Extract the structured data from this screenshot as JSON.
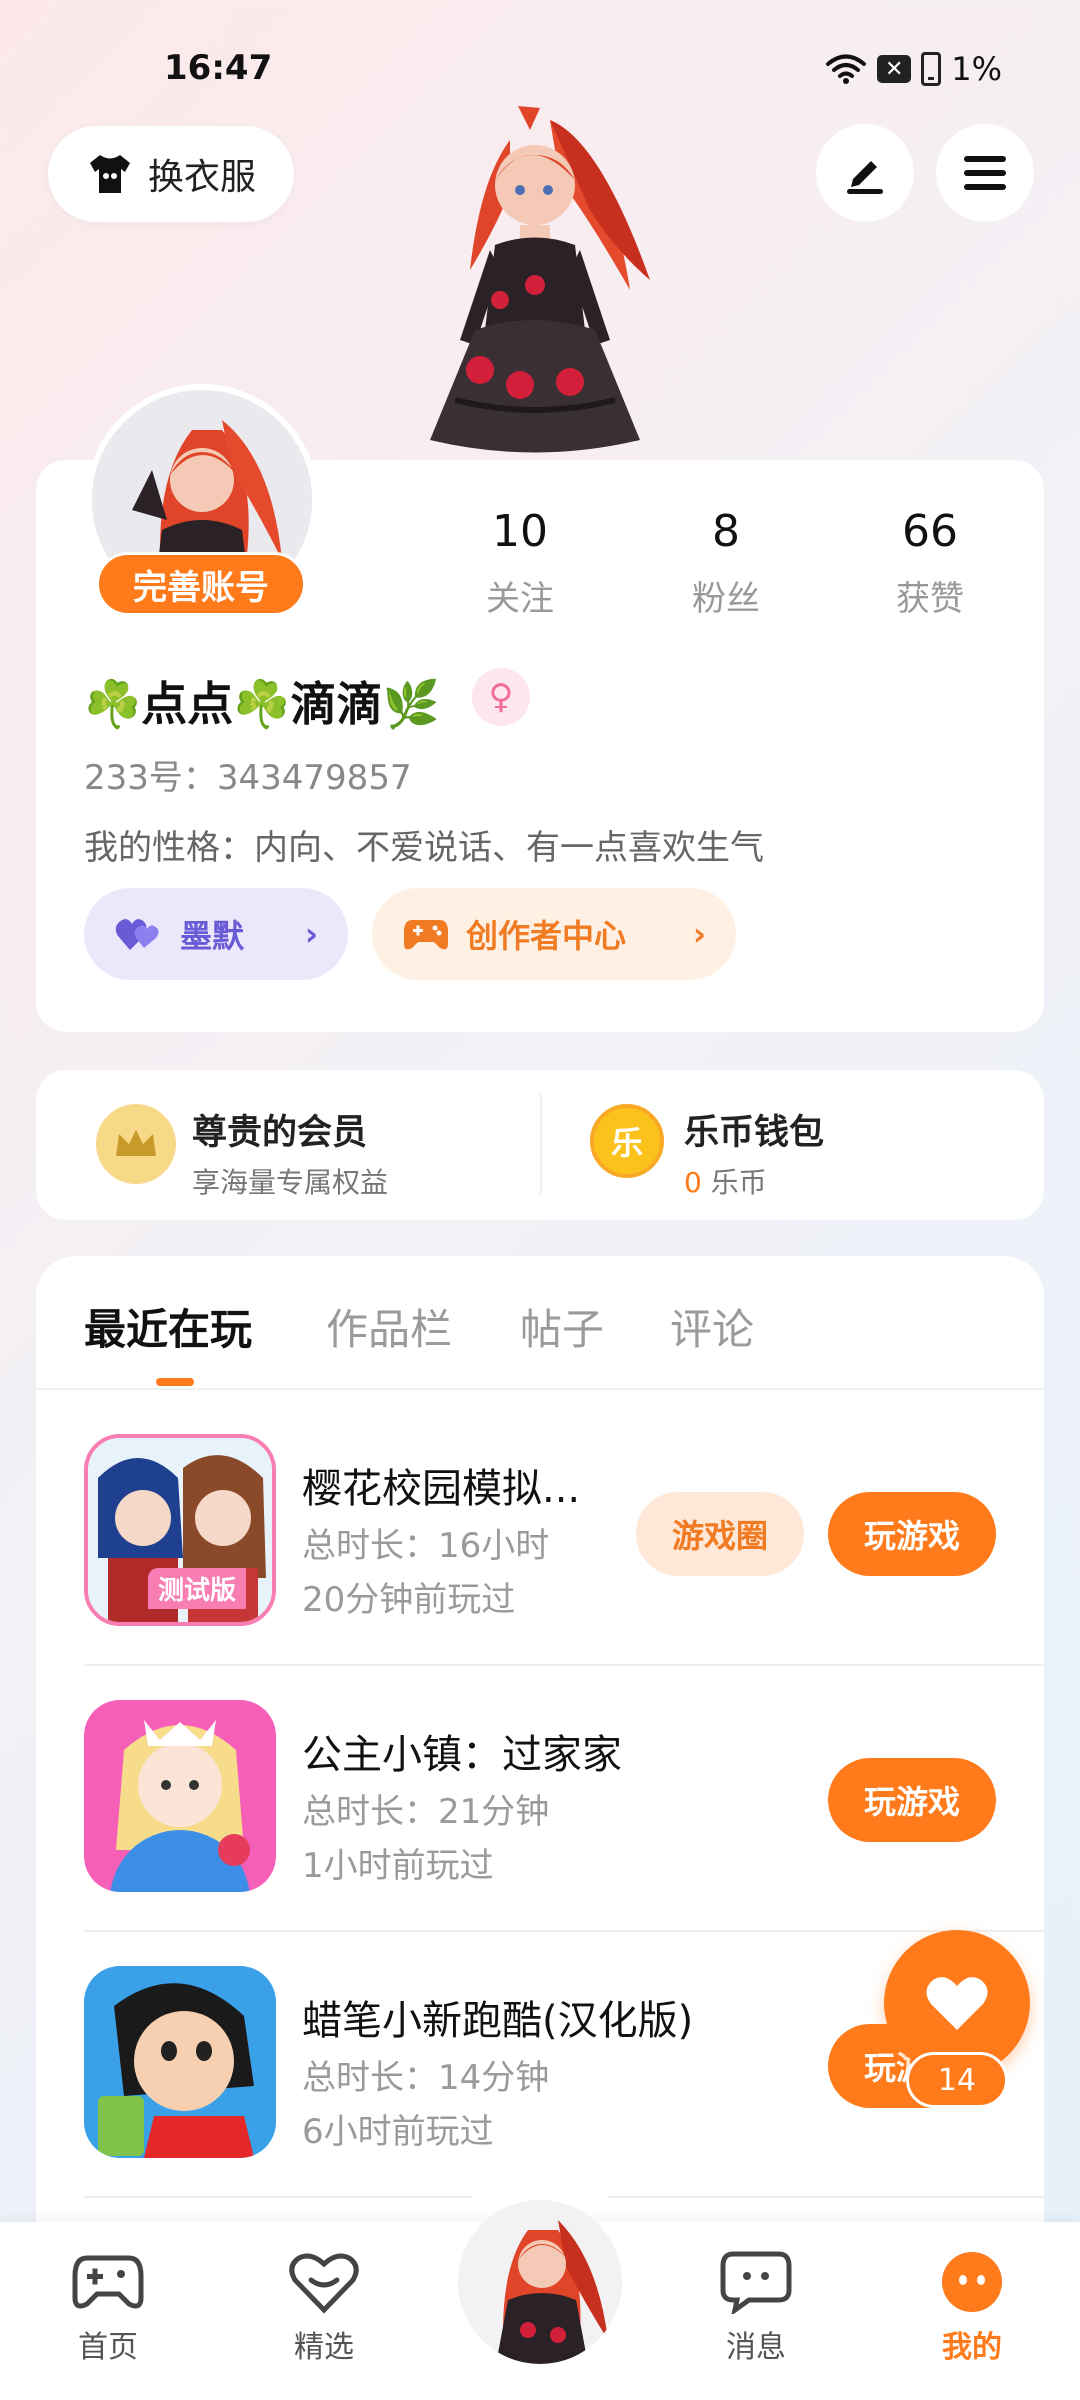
{
  "status_bar": {
    "time": "16:47",
    "battery": "1%"
  },
  "top": {
    "outfit_label": "换衣服"
  },
  "profile": {
    "complete_label": "完善账号",
    "stats": [
      {
        "value": "10",
        "label": "关注"
      },
      {
        "value": "8",
        "label": "粉丝"
      },
      {
        "value": "66",
        "label": "获赞"
      }
    ],
    "nickname": "☘️点点☘️滴滴🌿",
    "gender_symbol": "♀",
    "uid": "233号：343479857",
    "bio": "我的性格：内向、不爱说话、有一点喜欢生气",
    "mood_label": "墨默",
    "creator_label": "创作者中心"
  },
  "member": {
    "vip_title": "尊贵的会员",
    "vip_sub": "享海量专属权益",
    "wallet_title": "乐币钱包",
    "wallet_amount": "0",
    "wallet_unit": "乐币",
    "coin_char": "乐"
  },
  "tabs": [
    "最近在玩",
    "作品栏",
    "帖子",
    "评论"
  ],
  "games": [
    {
      "title": "樱花校园模拟...",
      "duration": "总时长：16小时",
      "last_played": "20分钟前玩过",
      "circle_label": "游戏圈",
      "play_label": "玩游戏",
      "badge": "测试版"
    },
    {
      "title": "公主小镇：过家家",
      "duration": "总时长：21分钟",
      "last_played": "1小时前玩过",
      "play_label": "玩游戏"
    },
    {
      "title": "蜡笔小新跑酷(汉化版)",
      "duration": "总时长：14分钟",
      "last_played": "6小时前玩过",
      "play_label": "玩游戏"
    }
  ],
  "float": {
    "like_count": "14"
  },
  "nav": {
    "items": [
      {
        "label": "首页",
        "icon": "gamepad-icon"
      },
      {
        "label": "精选",
        "icon": "heart-chat-icon"
      },
      {
        "label": "消息",
        "icon": "message-icon"
      },
      {
        "label": "我的",
        "icon": "me-icon"
      }
    ]
  },
  "colors": {
    "accent": "#ff7a1a",
    "purple": "#6a5ad6",
    "light_orange": "#ffe8d8"
  }
}
